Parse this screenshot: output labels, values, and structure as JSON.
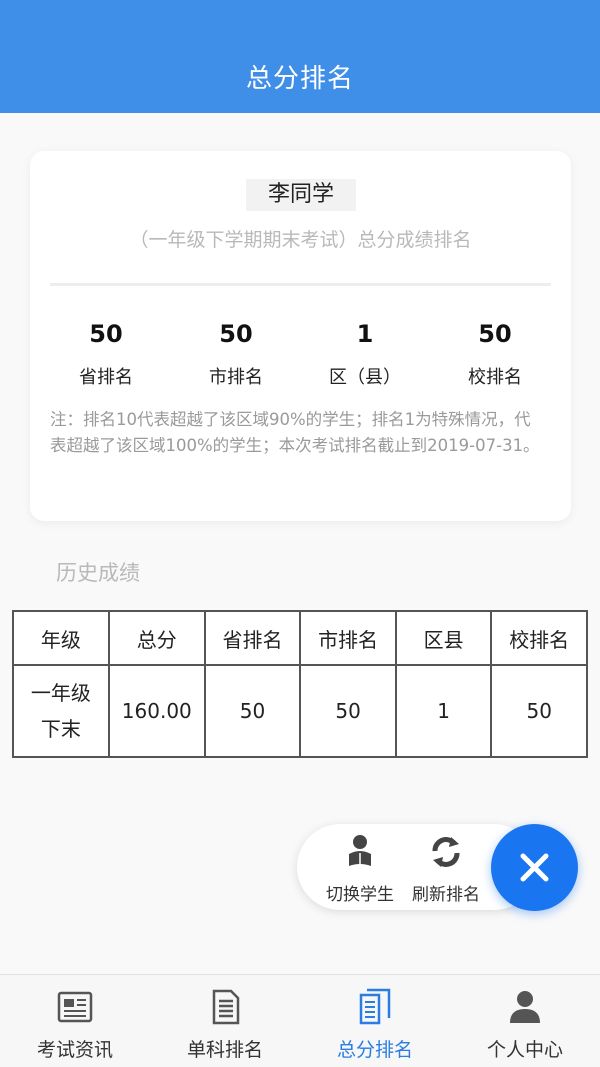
{
  "header": {
    "title": "总分排名"
  },
  "card": {
    "student_name": "李同学",
    "exam_title": "（一年级下学期期末考试）总分成绩排名",
    "ranks": [
      {
        "value": "50",
        "label": "省排名"
      },
      {
        "value": "50",
        "label": "市排名"
      },
      {
        "value": "1",
        "label": "区（县）"
      },
      {
        "value": "50",
        "label": "校排名"
      }
    ],
    "note": "注：排名10代表超越了该区域90%的学生；排名1为特殊情况，代表超越了该区域100%的学生；本次考试排名截止到2019-07-31。"
  },
  "history": {
    "title": "历史成绩",
    "headers": [
      "年级",
      "总分",
      "省排名",
      "市排名",
      "区县",
      "校排名"
    ],
    "rows": [
      [
        "一年级下末",
        "160.00",
        "50",
        "50",
        "1",
        "50"
      ]
    ]
  },
  "fab": {
    "switch_label": "切换学生",
    "refresh_label": "刷新排名",
    "close_icon": "close-icon"
  },
  "tabbar": {
    "items": [
      {
        "label": "考试资讯",
        "icon": "newspaper-icon",
        "active": false
      },
      {
        "label": "单科排名",
        "icon": "document-icon",
        "active": false
      },
      {
        "label": "总分排名",
        "icon": "documents-icon",
        "active": true
      },
      {
        "label": "个人中心",
        "icon": "person-icon",
        "active": false
      }
    ]
  },
  "colors": {
    "primary": "#3f8ee8",
    "fab": "#1976f0",
    "active_tab": "#2a7de1",
    "muted_text": "#b9b9b9"
  }
}
